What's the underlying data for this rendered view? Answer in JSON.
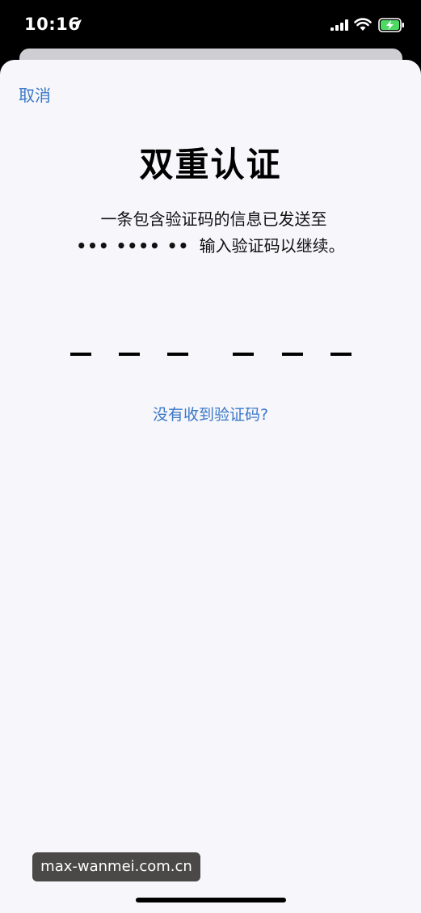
{
  "status_bar": {
    "time": "10:16",
    "icons": [
      "location-arrow-icon",
      "cellular-signal-icon",
      "wifi-icon",
      "battery-charging-icon"
    ]
  },
  "sheet": {
    "cancel_label": "取消",
    "title": "双重认证",
    "message_line1": "一条包含验证码的信息已发送至",
    "masked_number": "••• •••• ••",
    "message_line2": "输入验证码以继续。",
    "code_slots": 6,
    "code_value": "",
    "resend_link": "没有收到验证码?"
  },
  "watermark": "max-wanmei.com.cn",
  "colors": {
    "accent": "#3b78c8",
    "sheet_background": "#f6f6fb",
    "battery_green": "#4cd964"
  }
}
